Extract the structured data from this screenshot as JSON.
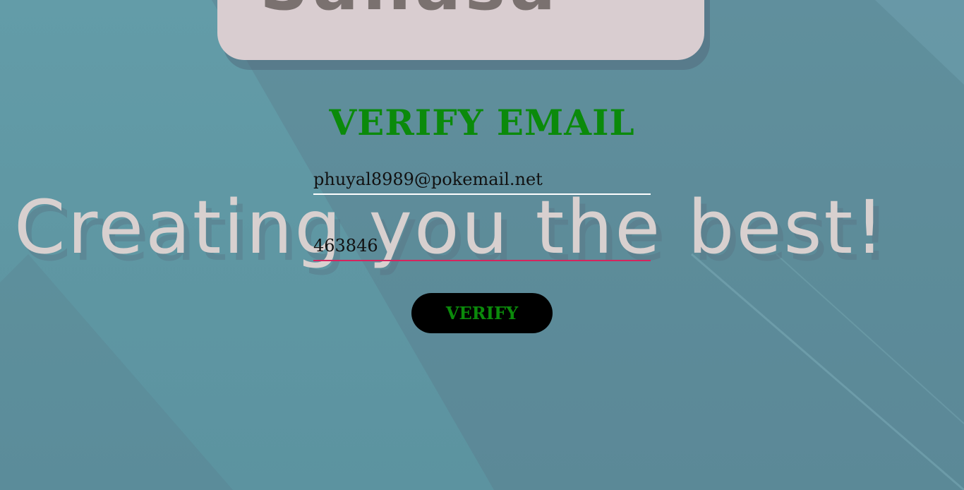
{
  "background": {
    "logo_text": "Sanasa",
    "slogan": "Creating you the best!"
  },
  "form": {
    "title": "VERIFY EMAIL",
    "email": {
      "value": "phuyal8989@pokemail.net"
    },
    "code": {
      "value": "463846"
    },
    "submit_label": "VERIFY"
  },
  "colors": {
    "title": "#0b8a0b",
    "button_bg": "#000000",
    "button_text": "#0b8a0b",
    "email_underline": "#ffffff",
    "code_underline": "#d6245e",
    "background": "#5f9aa6"
  }
}
